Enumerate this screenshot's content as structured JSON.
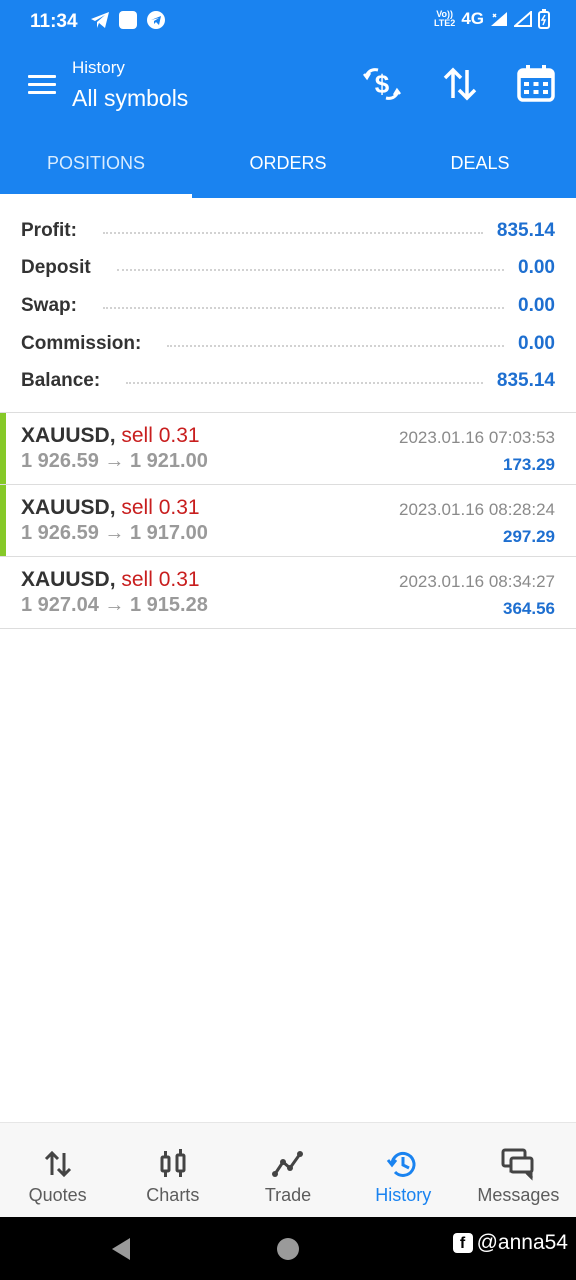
{
  "status_bar": {
    "time": "11:34",
    "network": "4G",
    "volte_line1": "Vo))",
    "volte_line2": "LTE2"
  },
  "header": {
    "subtitle": "History",
    "title": "All symbols",
    "icons": [
      "currency-exchange-icon",
      "sort-icon",
      "calendar-icon"
    ]
  },
  "tabs": [
    {
      "label": "POSITIONS",
      "active": true
    },
    {
      "label": "ORDERS",
      "active": false
    },
    {
      "label": "DEALS",
      "active": false
    }
  ],
  "summary": {
    "profit": {
      "label": "Profit:",
      "value": "835.14"
    },
    "deposit": {
      "label": "Deposit",
      "value": "0.00"
    },
    "swap": {
      "label": "Swap:",
      "value": "0.00"
    },
    "commission": {
      "label": "Commission:",
      "value": "0.00"
    },
    "balance": {
      "label": "Balance:",
      "value": "835.14"
    }
  },
  "deals": [
    {
      "symbol": "XAUUSD",
      "side": "sell 0.31",
      "open": "1 926.59",
      "close": "1 921.00",
      "time": "2023.01.16 07:03:53",
      "profit": "173.29",
      "highlight": true
    },
    {
      "symbol": "XAUUSD",
      "side": "sell 0.31",
      "open": "1 926.59",
      "close": "1 917.00",
      "time": "2023.01.16 08:28:24",
      "profit": "297.29",
      "highlight": true
    },
    {
      "symbol": "XAUUSD",
      "side": "sell 0.31",
      "open": "1 927.04",
      "close": "1 915.28",
      "time": "2023.01.16 08:34:27",
      "profit": "364.56",
      "highlight": false
    }
  ],
  "bottom_nav": [
    {
      "label": "Quotes",
      "icon": "quotes-icon",
      "active": false
    },
    {
      "label": "Charts",
      "icon": "charts-icon",
      "active": false
    },
    {
      "label": "Trade",
      "icon": "trade-icon",
      "active": false
    },
    {
      "label": "History",
      "icon": "history-icon",
      "active": true
    },
    {
      "label": "Messages",
      "icon": "messages-icon",
      "active": false
    }
  ],
  "watermark": {
    "text": "@anna54"
  },
  "colors": {
    "brand_blue": "#1a83f0",
    "value_blue": "#1e6fd0",
    "sell_red": "#c81e1e",
    "profit_bar_green": "#86c928"
  }
}
